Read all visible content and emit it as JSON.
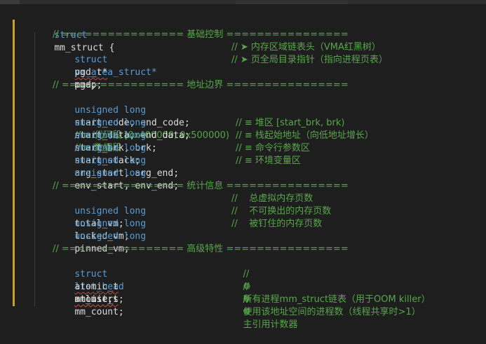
{
  "struct_decl": {
    "keyword": "struct",
    "name": "mm_struct {"
  },
  "sec1": {
    "header": "// ================ 基础控制 ================"
  },
  "line_mmap": {
    "kw": "struct",
    "type": "vm_area_struct*",
    "decl": "mmap;",
    "comment": "// ➤ 内存区域链表头（VMA红黑树）"
  },
  "line_pgd": {
    "type": "pgd_t*",
    "decl": "pgd;",
    "comment": "// ➤ 页全局目录指针（指向进程页表）"
  },
  "sec2": {
    "header": "// ================ 地址边界 ================"
  },
  "line_code": {
    "kw": "unsigned long",
    "decl": "start_code, end_code;",
    "comment": "// ≡ 代码段 [0x400000, 0x500000)"
  },
  "line_data": {
    "kw": "unsigned long",
    "decl": "start_data, end_data;",
    "comment": "// ≡ 数据段"
  },
  "line_brk": {
    "kw": "unsigned long",
    "decl": "start_brk, brk;",
    "comment": "// ≡ 堆区 [start_brk, brk)"
  },
  "line_stack": {
    "kw": "unsigned long",
    "decl": "start_stack;",
    "comment": "// ≡ 栈起始地址（向低地址增长）"
  },
  "line_arg": {
    "kw": "unsigned long",
    "decl": "arg_start, arg_end;",
    "comment": "// ≡ 命令行参数区"
  },
  "line_env": {
    "kw": "unsigned long",
    "decl": "env_start, env_end;",
    "comment": "// ≡ 环境变量区"
  },
  "sec3": {
    "header": "// ================ 统计信息 ================"
  },
  "line_total": {
    "kw": "unsigned long",
    "decl": "total_vm;",
    "comment": "//    总虚拟内存页数"
  },
  "line_locked": {
    "kw": "unsigned long",
    "decl": "locked_vm;",
    "comment": "//    不可换出的内存页数"
  },
  "line_pinned": {
    "kw": "unsigned long",
    "decl": "pinned_vm;",
    "comment": "//    被钉住的内存页数"
  },
  "sec4": {
    "header": "// ================ 高级特性 ================"
  },
  "line_mmlist": {
    "kw": "struct",
    "type": "list_head",
    "decl": "mmlist;",
    "comment_mark": "//",
    "icon": "❁",
    "comment": "所有进程mm_struct链表（用于OOM killer）"
  },
  "line_users": {
    "type": "atomic_t",
    "decl": "mm_users;",
    "comment_mark": "//",
    "icon": "❁",
    "comment": "使用该地址空间的进程数（线程共享时>1）"
  },
  "line_count": {
    "type": "atomic_t",
    "decl": "mm_count;",
    "comment_mark": "//",
    "icon": "❁",
    "comment": "主引用计数器"
  },
  "colors": {
    "background": "#1e1e1e",
    "keyword": "#569cd6",
    "comment": "#57a64a",
    "text": "#dcdcdc",
    "gutter": "#c9a227"
  }
}
